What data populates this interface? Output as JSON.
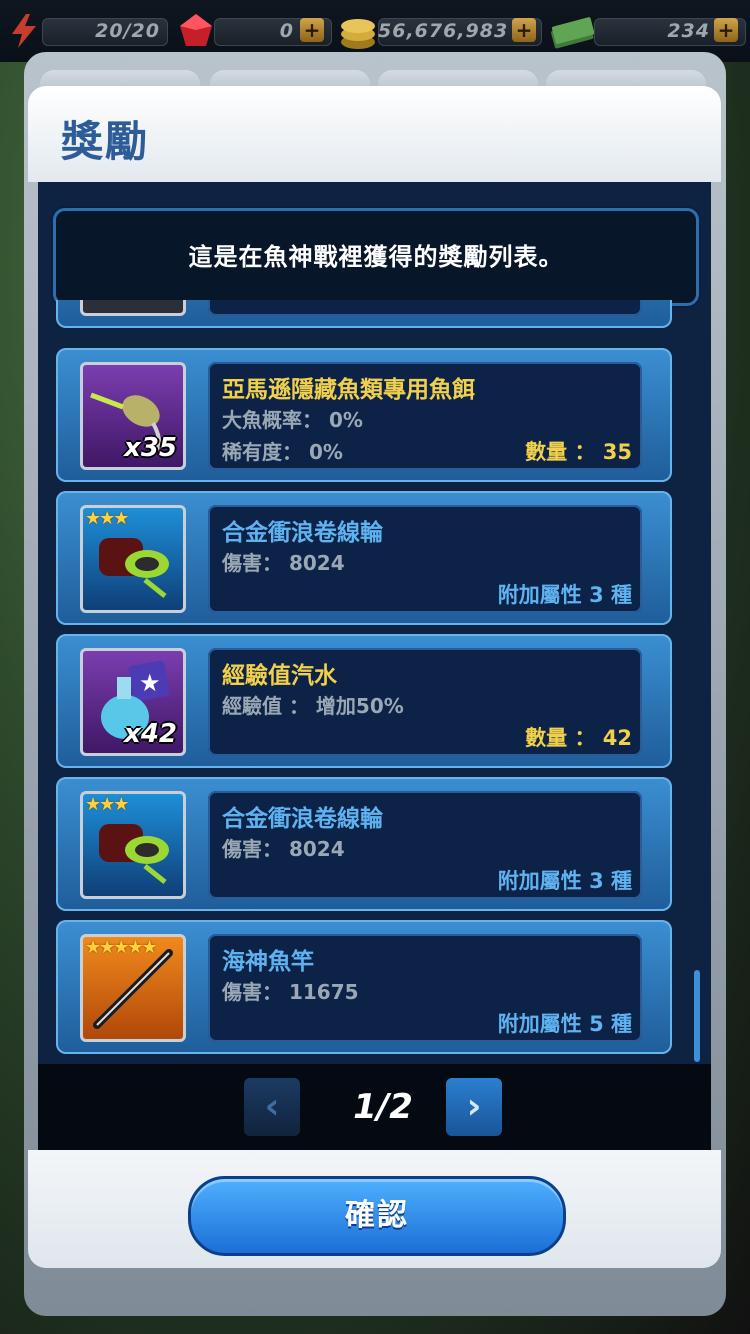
{
  "topbar": {
    "energy": "20/20",
    "gems": "0",
    "coins": "56,676,983",
    "cash": "234"
  },
  "dialog": {
    "title": "獎勵",
    "notice": "這是在魚神戰裡獲得的獎勵列表。",
    "items": [
      {
        "name": "亞馬遜隱藏魚類專用魚餌",
        "line1": "大魚概率： 0%",
        "line2": "稀有度： 0%",
        "right": "數量 ： 35",
        "qty": "x35",
        "icon": "bait-icon"
      },
      {
        "name": "合金衝浪卷線輪",
        "line1": "傷害： 8024",
        "line2": "",
        "right": "附加屬性 3 種",
        "stars": "★★★",
        "icon": "reel-icon"
      },
      {
        "name": "經驗值汽水",
        "line1": "經驗值 ： 增加50%",
        "line2": "",
        "right": "數量 ： 42",
        "qty": "x42",
        "icon": "potion-icon"
      },
      {
        "name": "合金衝浪卷線輪",
        "line1": "傷害： 8024",
        "line2": "",
        "right": "附加屬性 3 種",
        "stars": "★★★",
        "icon": "reel-icon"
      },
      {
        "name": "海神魚竿",
        "line1": "傷害： 11675",
        "line2": "",
        "right": "附加屬性 5 種",
        "stars": "★★★★★",
        "icon": "rod-icon"
      }
    ],
    "pager": {
      "text": "1/2",
      "prev": "‹",
      "next": "›"
    },
    "confirm_label": "確認"
  },
  "colors": {
    "accent": "#2e5c98",
    "gold": "#f1d04b",
    "blue_text": "#5fb2f0"
  }
}
